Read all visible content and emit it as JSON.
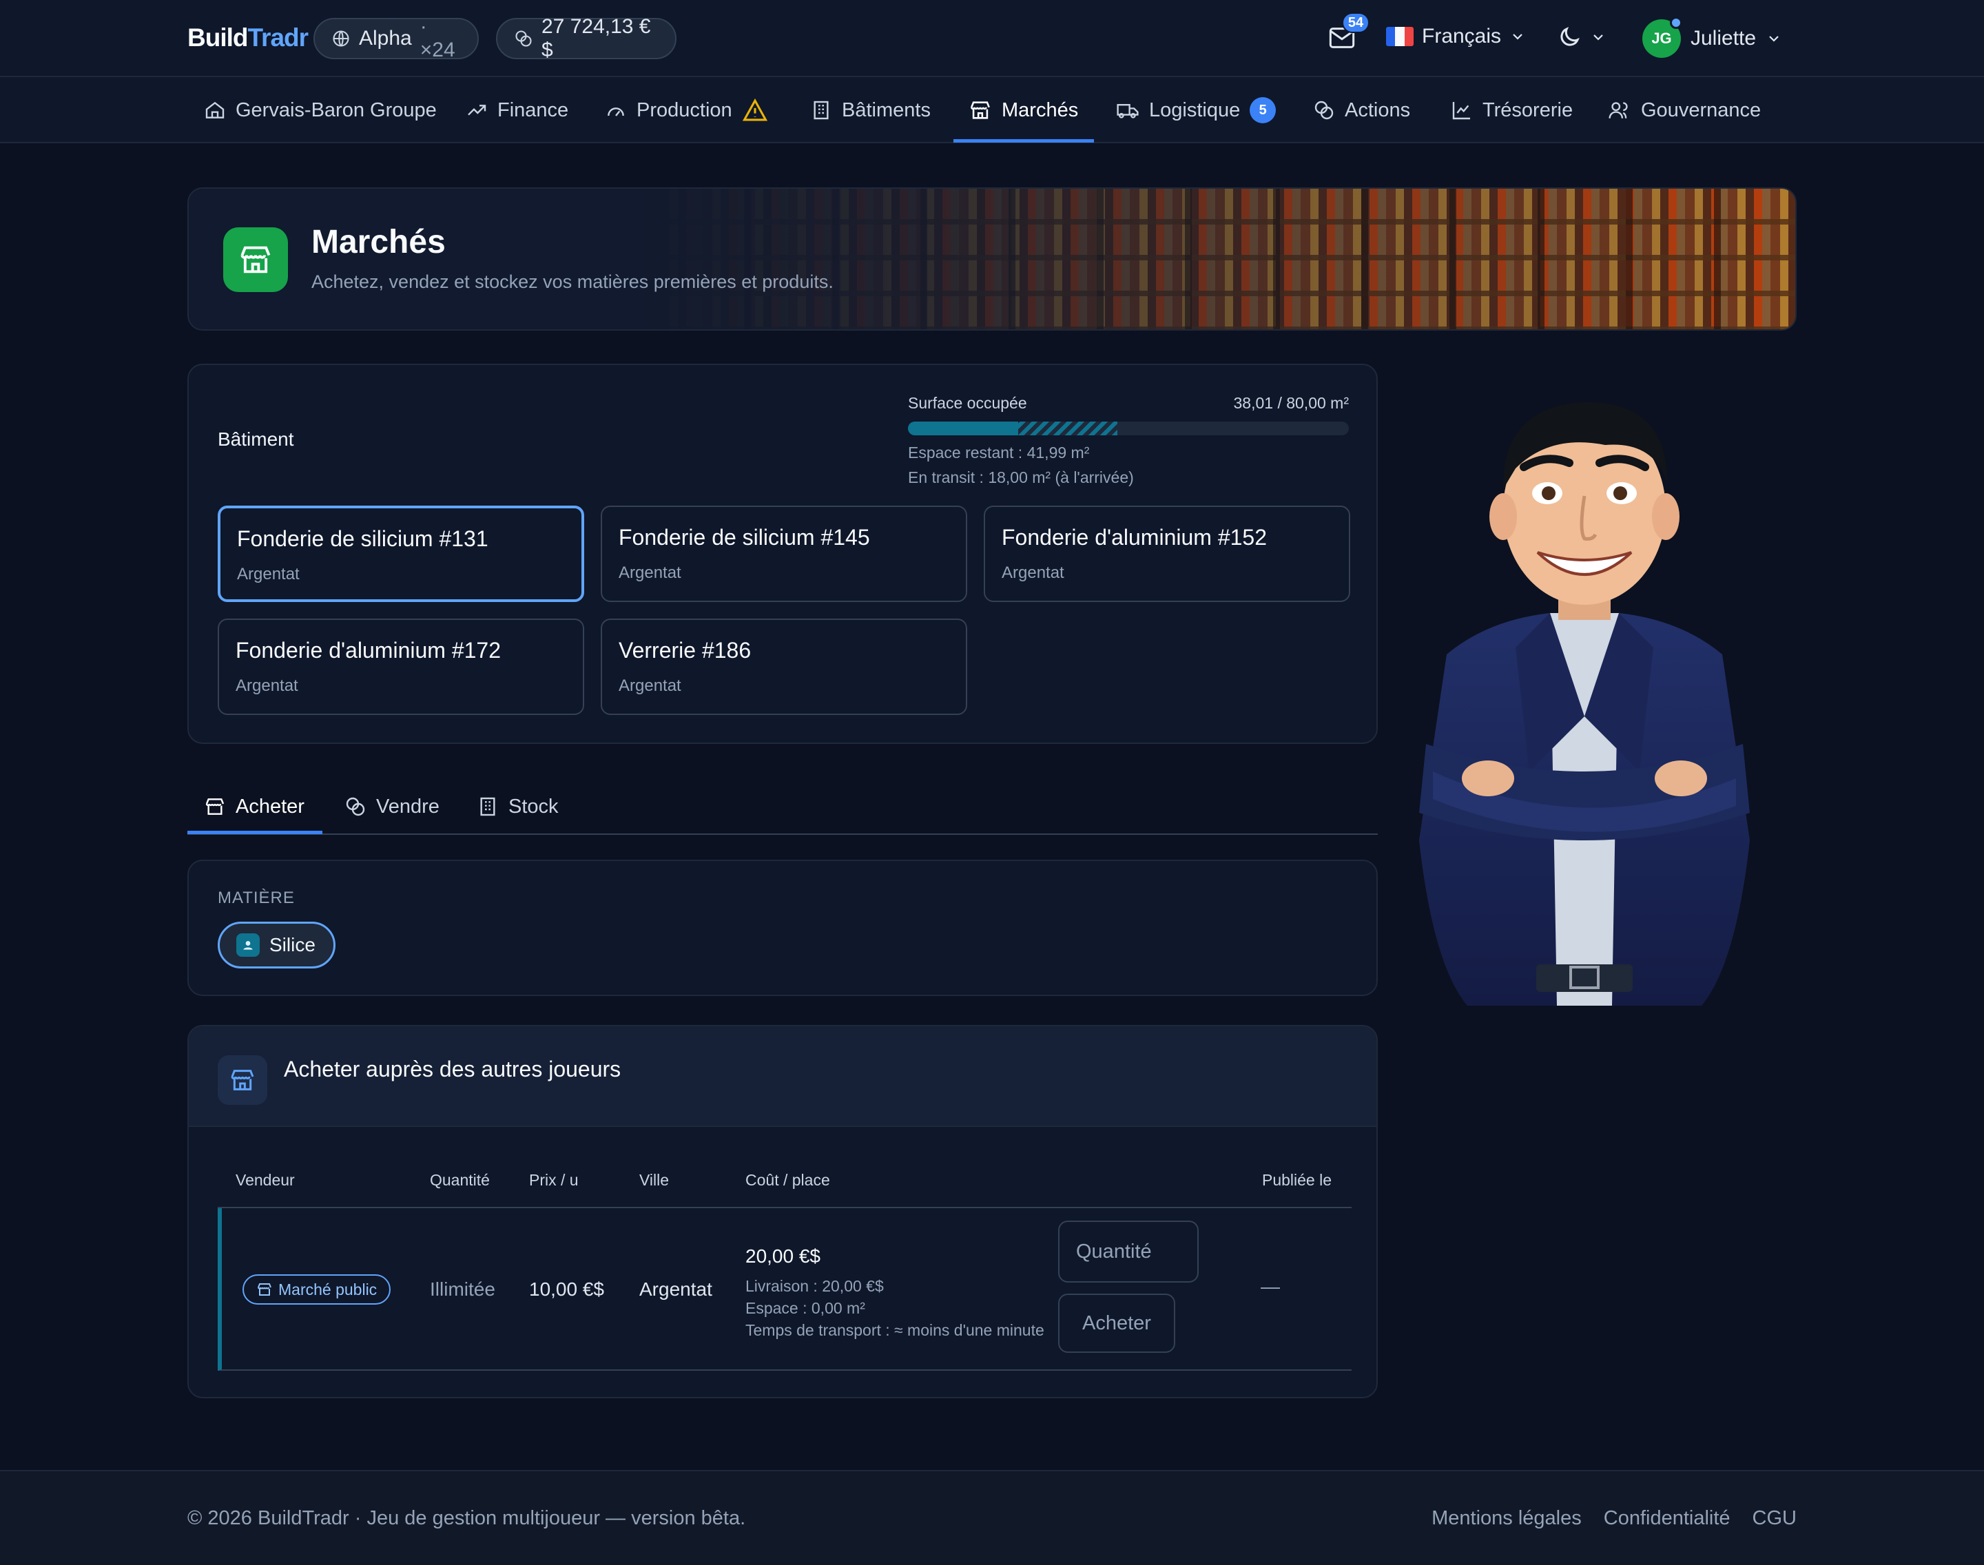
{
  "header": {
    "logo_part1": "Build",
    "logo_part2": "Tradr",
    "world_name": "Alpha",
    "world_speed": "· ×24",
    "balance": "27 724,13 €$",
    "mail_count": "54",
    "language": "Français",
    "user_initials": "JG",
    "user_name": "Juliette"
  },
  "nav": {
    "items": [
      {
        "label": "Gervais-Baron Groupe",
        "icon": "home-icon"
      },
      {
        "label": "Finance",
        "icon": "trend-up-icon"
      },
      {
        "label": "Production",
        "icon": "gauge-icon"
      },
      {
        "label": "Bâtiments",
        "icon": "building-icon"
      },
      {
        "label": "Marchés",
        "icon": "store-icon"
      },
      {
        "label": "Logistique",
        "icon": "truck-icon"
      },
      {
        "label": "Actions",
        "icon": "coins-icon"
      },
      {
        "label": "Trésorerie",
        "icon": "chart-line-icon"
      },
      {
        "label": "Gouvernance",
        "icon": "users-icon"
      }
    ],
    "active": "Marchés",
    "logistique_badge": "5"
  },
  "hero": {
    "title": "Marchés",
    "subtitle": "Achetez, vendez et stockez vos matières premières et produits."
  },
  "building_section": {
    "label": "Bâtiment",
    "surface_label": "Surface occupée",
    "surface_value": "38,01 / 80,00 m²",
    "occupied_fraction": 0.25,
    "transit_fraction": 0.225,
    "remaining": "Espace restant : 41,99 m²",
    "transit": "En transit : 18,00 m² (à l'arrivée)",
    "buildings": [
      {
        "name": "Fonderie de silicium #131",
        "city": "Argentat",
        "selected": true
      },
      {
        "name": "Fonderie de silicium #145",
        "city": "Argentat"
      },
      {
        "name": "Fonderie d'aluminium #152",
        "city": "Argentat"
      },
      {
        "name": "Fonderie d'aluminium #172",
        "city": "Argentat"
      },
      {
        "name": "Verrerie #186",
        "city": "Argentat"
      }
    ]
  },
  "tabs": [
    {
      "label": "Acheter",
      "active": true
    },
    {
      "label": "Vendre"
    },
    {
      "label": "Stock"
    }
  ],
  "material": {
    "label": "MATIÈRE",
    "selected": "Silice"
  },
  "buy_section": {
    "title": "Acheter auprès des autres joueurs",
    "columns": [
      "Vendeur",
      "Quantité",
      "Prix / u",
      "Ville",
      "Coût / place",
      "Publiée le"
    ],
    "rows": [
      {
        "seller": "Marché public",
        "quantity": "Illimitée",
        "price": "10,00 €$",
        "city": "Argentat",
        "cost": "20,00 €$",
        "delivery": "Livraison : 20,00 €$",
        "space": "Espace : 0,00 m²",
        "transport": "Temps de transport : ≈ moins d'une minute",
        "quantity_placeholder": "Quantité",
        "buy_label": "Acheter",
        "published": "—"
      }
    ]
  },
  "footer": {
    "copyright": "© 2026 BuildTradr · Jeu de gestion multijoueur — version bêta.",
    "links": [
      "Mentions légales",
      "Confidentialité",
      "CGU"
    ]
  },
  "colors": {
    "background": "#0b1120",
    "card": "#0f172a",
    "accent": "#3b82f6",
    "success": "#16a34a",
    "teal": "#0e7490",
    "warning": "#eab308"
  }
}
